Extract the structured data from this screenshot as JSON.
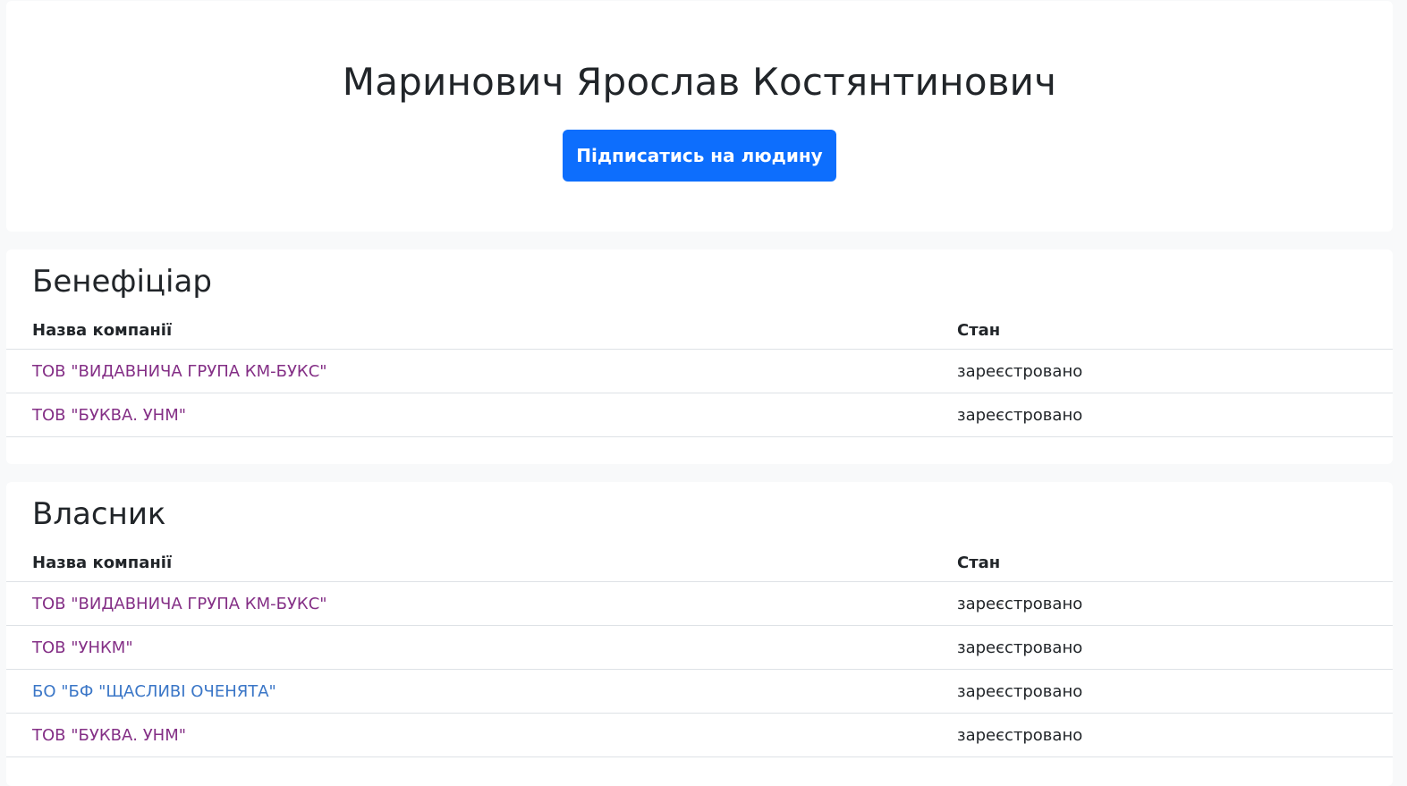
{
  "person": {
    "name": "Маринович Ярослав Костянтинович",
    "subscribe_label": "Підписатись на людину"
  },
  "sections": {
    "beneficiary": {
      "title": "Бенефіціар",
      "headers": {
        "company": "Назва компанії",
        "status": "Стан"
      },
      "rows": [
        {
          "company": "ТОВ \"ВИДАВНИЧА ГРУПА КМ-БУКС\"",
          "status": "зареєстровано"
        },
        {
          "company": "ТОВ \"БУКВА. УНМ\"",
          "status": "зареєстровано"
        }
      ]
    },
    "owner": {
      "title": "Власник",
      "headers": {
        "company": "Назва компанії",
        "status": "Стан"
      },
      "rows": [
        {
          "company": "ТОВ \"ВИДАВНИЧА ГРУПА КМ-БУКС\"",
          "status": "зареєстровано"
        },
        {
          "company": "ТОВ \"УНКМ\"",
          "status": "зареєстровано"
        },
        {
          "company": "БО \"БФ \"ЩАСЛИВІ ОЧЕНЯТА\"",
          "status": "зареєстровано"
        },
        {
          "company": "ТОВ \"БУКВА. УНМ\"",
          "status": "зареєстровано"
        }
      ]
    }
  },
  "colors": {
    "primary_button": "#0d6efd",
    "visited_link": "#842f86",
    "link": "#3a76c7",
    "page_background": "#f8f9fa"
  }
}
